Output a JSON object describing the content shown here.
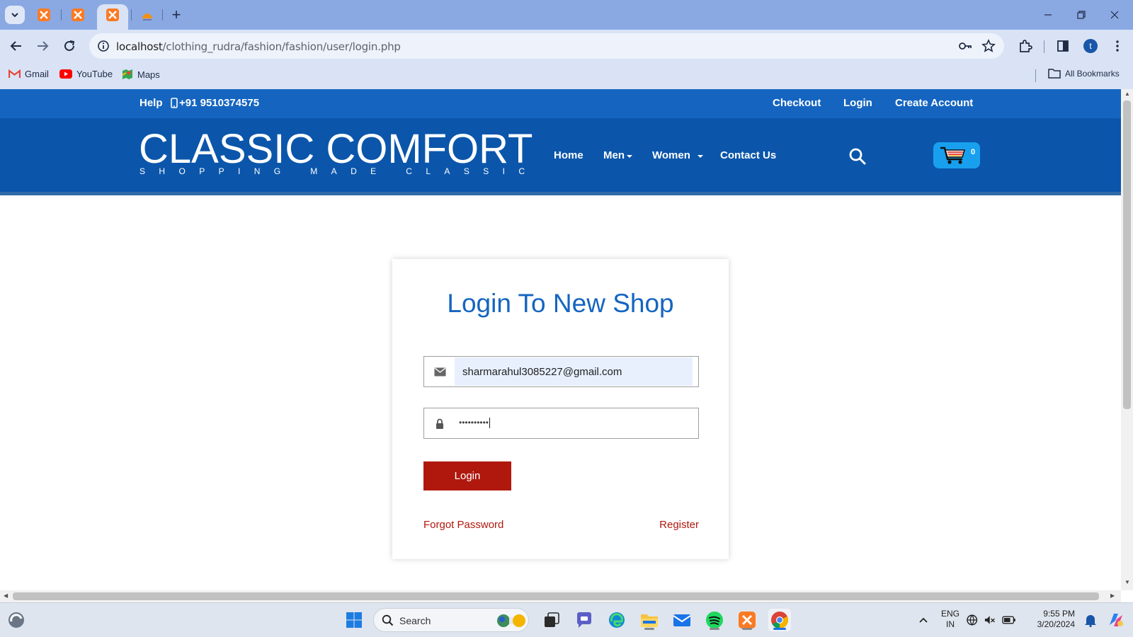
{
  "browser": {
    "address_bar": {
      "host": "localhost",
      "path": "/clothing_rudra/fashion/fashion/user/login.php"
    },
    "profile_initial": "t",
    "bookmarks": [
      {
        "label": "Gmail",
        "icon": "gmail-icon"
      },
      {
        "label": "YouTube",
        "icon": "youtube-icon"
      },
      {
        "label": "Maps",
        "icon": "maps-icon"
      }
    ],
    "all_bookmarks_label": "All Bookmarks"
  },
  "site": {
    "topbar": {
      "help": "Help",
      "phone": "+91 9510374575",
      "links": [
        "Checkout",
        "Login",
        "Create Account"
      ]
    },
    "logo": {
      "title": "CLASSIC COMFORT",
      "tagline": "SHOPPING MADE CLASSIC"
    },
    "nav": [
      "Home",
      "Men",
      "Women",
      "Contact Us"
    ],
    "cart_count": "0",
    "login_form": {
      "title": "Login To New Shop",
      "email_value": "sharmarahul3085227@gmail.com",
      "password_mask": "••••••••••",
      "login_button": "Login",
      "forgot_password": "Forgot Password",
      "register": "Register"
    }
  },
  "taskbar": {
    "search_label": "Search",
    "language_line1": "ENG",
    "language_line2": "IN",
    "time": "9:55 PM",
    "date": "3/20/2024"
  },
  "colors": {
    "brand_blue": "#1565c0",
    "nav_blue": "#0b56ab",
    "login_red": "#b0180e",
    "cart_blue": "#18a0ef"
  }
}
